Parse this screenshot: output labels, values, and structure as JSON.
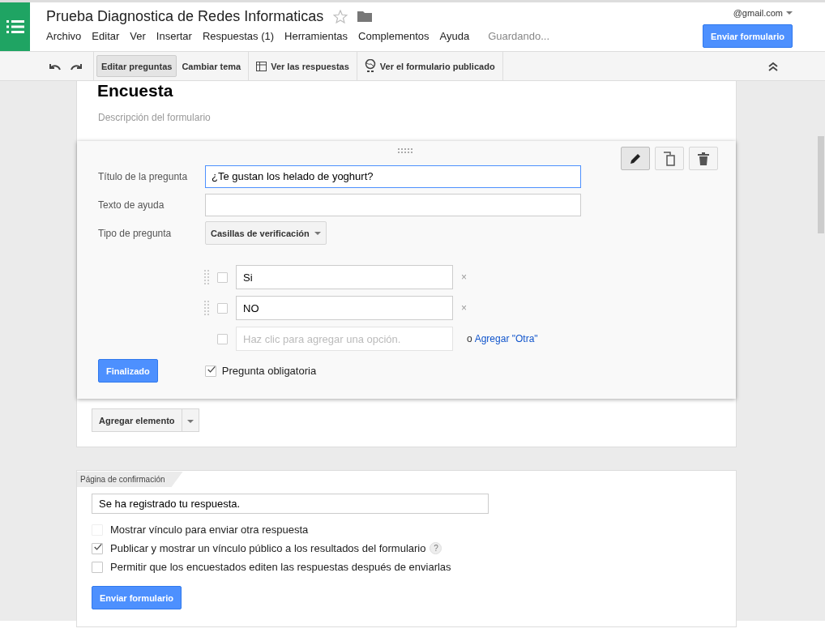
{
  "header": {
    "title": "Prueba Diagnostica de Redes Informaticas",
    "account": "@gmail.com",
    "menu": [
      "Archivo",
      "Editar",
      "Ver",
      "Insertar",
      "Respuestas (1)",
      "Herramientas",
      "Complementos",
      "Ayuda"
    ],
    "status": "Guardando...",
    "send_button": "Enviar formulario"
  },
  "toolbar": {
    "buttons": [
      {
        "label": "Editar preguntas",
        "selected": true,
        "kind": "plain"
      },
      {
        "label": "Cambiar tema",
        "selected": false,
        "kind": "plain"
      },
      {
        "label": "Ver las respuestas",
        "selected": false,
        "kind": "table"
      },
      {
        "label": "Ver el formulario publicado",
        "selected": false,
        "kind": "globe"
      }
    ]
  },
  "form": {
    "title": "Encuesta",
    "description_placeholder": "Descripción del formulario"
  },
  "question": {
    "title_label": "Título de la pregunta",
    "title_value": "¿Te gustan los helado de yoghurt?",
    "help_label": "Texto de ayuda",
    "type_label": "Tipo de pregunta",
    "type_value": "Casillas de verificación",
    "options": [
      {
        "value": "Si",
        "remove": "×",
        "checked": false
      },
      {
        "value": "NO",
        "remove": "×",
        "checked": false
      }
    ],
    "add_option_checked": false,
    "add_option_placeholder": "Haz clic para agregar una opción.",
    "or_text": "o",
    "add_other_link": "Agregar \"Otra\"",
    "done_button": "Finalizado",
    "required_label": "Pregunta obligatoria",
    "required": true
  },
  "add_item_button": "Agregar elemento",
  "confirmation": {
    "tab_label": "Página de confirmación",
    "message": "Se ha registrado tu respuesta.",
    "options": [
      {
        "label": "Mostrar vínculo para enviar otra respuesta",
        "checked": false,
        "disabled": true,
        "help": false
      },
      {
        "label": "Publicar y mostrar un vínculo público a los resultados del formulario",
        "checked": true,
        "disabled": false,
        "help": true
      },
      {
        "label": "Permitir que los encuestados editen las respuestas después de enviarlas",
        "checked": false,
        "disabled": false,
        "help": false
      }
    ],
    "help_mark": "?",
    "send_button": "Enviar formulario"
  }
}
